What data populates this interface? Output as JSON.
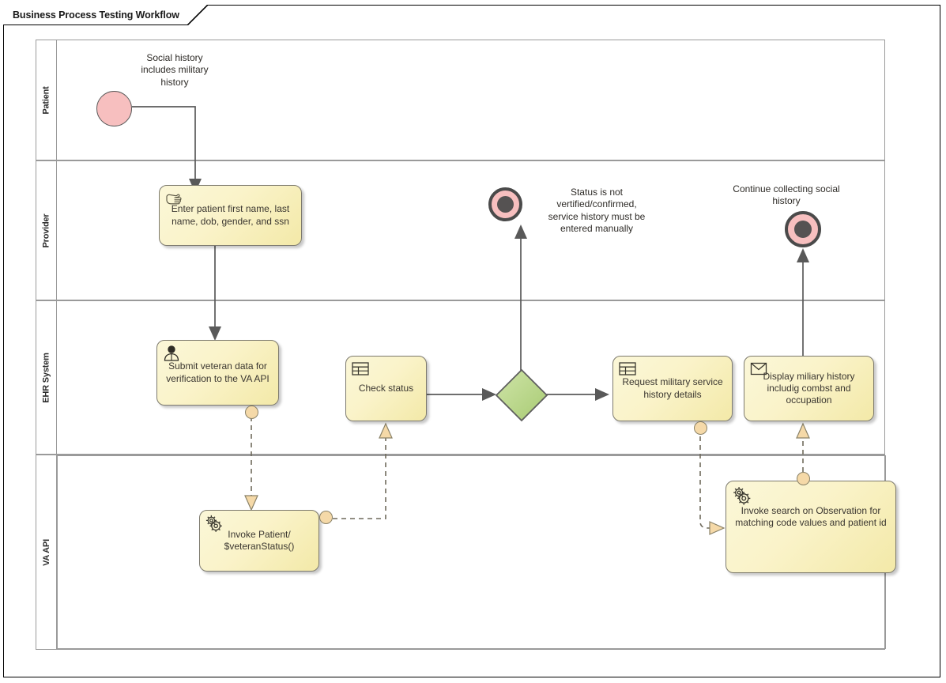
{
  "diagram": {
    "title": "Business Process Testing Workflow",
    "type": "bpmn-collaboration-diagram"
  },
  "lanes": [
    {
      "id": "patient",
      "label": "Patient"
    },
    {
      "id": "provider",
      "label": "Provider"
    },
    {
      "id": "ehr",
      "label": "EHR System"
    },
    {
      "id": "vaapi",
      "label": "VA API"
    }
  ],
  "events": [
    {
      "id": "start-social-history",
      "kind": "start-event",
      "lane": "patient",
      "label": "",
      "color": "#F7BFBF"
    },
    {
      "id": "end-not-verified",
      "kind": "end-event",
      "lane": "provider",
      "label": "",
      "color": "#F7BFBF"
    },
    {
      "id": "end-continue-collecting",
      "kind": "end-event",
      "lane": "provider",
      "label": "",
      "color": "#F7BFBF"
    }
  ],
  "annotations": [
    {
      "id": "note-social-history",
      "text": "Social history\nincludes military\nhistory"
    },
    {
      "id": "note-status-not-verified",
      "text": "Status is not\nvertified/confirmed,\nservice history must be\nentered manually"
    },
    {
      "id": "note-continue-collecting",
      "text": "Continue collecting social\nhistory"
    }
  ],
  "tasks": [
    {
      "id": "enter-patient-demographics",
      "lane": "provider",
      "icon": "manual-task-hand-icon",
      "label": "Enter patient first name, last\nname, dob, gender, and ssn"
    },
    {
      "id": "submit-veteran-data",
      "lane": "ehr",
      "icon": "user-task-person-icon",
      "label": "Submit veteran data for\nverification to the VA API"
    },
    {
      "id": "check-status",
      "lane": "ehr",
      "icon": "business-rule-task-table-icon",
      "label": "Check status"
    },
    {
      "id": "request-military-service-history",
      "lane": "ehr",
      "icon": "business-rule-task-table-icon",
      "label": "Request military service\nhistory details"
    },
    {
      "id": "display-military-history",
      "lane": "ehr",
      "icon": "send-task-envelope-icon",
      "label": "Display miliary history\nincludig combst and\noccupation"
    },
    {
      "id": "invoke-patient-veteran-status",
      "lane": "vaapi",
      "icon": "service-task-gears-icon",
      "label": "Invoke Patient/\n$veteranStatus()"
    },
    {
      "id": "invoke-search-observation",
      "lane": "vaapi",
      "icon": "service-task-gears-icon",
      "label": "Invoke search on Observation for\nmatching code values and patient id"
    }
  ],
  "gateways": [
    {
      "id": "status-gateway",
      "kind": "exclusive-gateway",
      "lane": "ehr",
      "label": "",
      "color": "#B9D88A"
    }
  ],
  "colors": {
    "task_fill_light": "#FBF7D8",
    "task_fill_dark": "#F3E9A8",
    "task_stroke": "#7D7A6E",
    "event_fill": "#F7BFBF",
    "event_stroke": "#4A4A4A",
    "gateway_fill": "#B9D88A",
    "gateway_stroke": "#5E5E5E",
    "lane_stroke": "#9A9A9A",
    "message_marker_fill": "#F5D9A8",
    "flow_stroke": "#5A5A5A",
    "frame_stroke": "#000000"
  }
}
